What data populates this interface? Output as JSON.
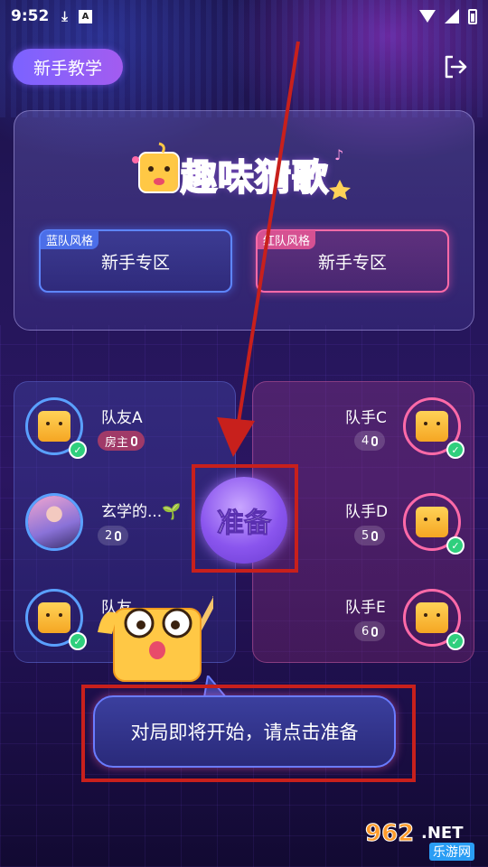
{
  "status_bar": {
    "time": "9:52",
    "a_badge": "A"
  },
  "header": {
    "tutorial_label": "新手教学"
  },
  "hero": {
    "title": "趣味猜歌",
    "blue_zone": {
      "tag": "蓝队风格",
      "label": "新手专区"
    },
    "red_zone": {
      "tag": "红队风格",
      "label": "新手专区"
    }
  },
  "blue_team": [
    {
      "name": "队友A",
      "chip": "房主",
      "chip_type": "host",
      "avatar": "cube-dog"
    },
    {
      "name": "玄学的...🌱",
      "chip": "2",
      "chip_type": "seat",
      "avatar": "photo"
    },
    {
      "name": "队友",
      "chip": "",
      "chip_type": "hidden",
      "avatar": "cube-wink"
    }
  ],
  "red_team": [
    {
      "name": "队手C",
      "chip": "4",
      "avatar": "cube-smile"
    },
    {
      "name": "队手D",
      "chip": "5",
      "avatar": "cube-sunglasses"
    },
    {
      "name": "队手E",
      "chip": "6",
      "avatar": "cube-frown"
    }
  ],
  "ready_button": {
    "label": "准备"
  },
  "tip": {
    "text": "对局即将开始，请点击准备"
  },
  "watermark": {
    "number": "962",
    "suffix": ".NET",
    "cn": "乐游网"
  },
  "colors": {
    "blue_accent": "#5aa0ff",
    "red_accent": "#ff6aa8",
    "highlight": "#c8201c",
    "ready_purple": "#8a55ee"
  }
}
